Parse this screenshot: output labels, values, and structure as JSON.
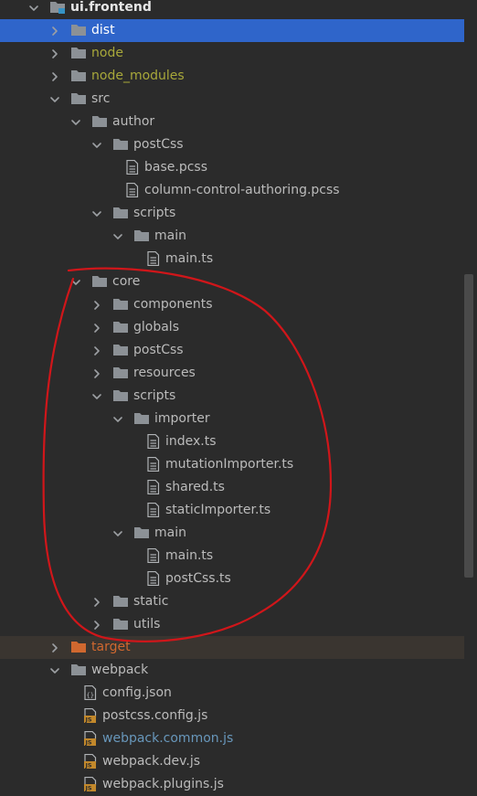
{
  "colors": {
    "default_text": "#bbbbbb",
    "ignored_text": "#a8a83a",
    "excluded_text": "#d0682f",
    "modified_text": "#6897bb",
    "selection": "#2f65ca",
    "folder_icon": "#8c9196",
    "annotation": "#d0161a"
  },
  "tree": [
    {
      "label": "ui.frontend",
      "depth": 1,
      "kind": "module-folder",
      "expanded": true,
      "bold": true
    },
    {
      "label": "dist",
      "depth": 2,
      "kind": "folder",
      "expanded": false,
      "selected": true
    },
    {
      "label": "node",
      "depth": 2,
      "kind": "folder",
      "expanded": false,
      "status": "ignored"
    },
    {
      "label": "node_modules",
      "depth": 2,
      "kind": "folder",
      "expanded": false,
      "status": "ignored"
    },
    {
      "label": "src",
      "depth": 2,
      "kind": "folder",
      "expanded": true
    },
    {
      "label": "author",
      "depth": 3,
      "kind": "folder",
      "expanded": true
    },
    {
      "label": "postCss",
      "depth": 4,
      "kind": "folder",
      "expanded": true
    },
    {
      "label": "base.pcss",
      "depth": 5,
      "kind": "file"
    },
    {
      "label": "column-control-authoring.pcss",
      "depth": 5,
      "kind": "file"
    },
    {
      "label": "scripts",
      "depth": 4,
      "kind": "folder",
      "expanded": true
    },
    {
      "label": "main",
      "depth": 5,
      "kind": "folder",
      "expanded": true
    },
    {
      "label": "main.ts",
      "depth": 6,
      "kind": "file"
    },
    {
      "label": "core",
      "depth": 3,
      "kind": "folder",
      "expanded": true
    },
    {
      "label": "components",
      "depth": 4,
      "kind": "folder",
      "expanded": false
    },
    {
      "label": "globals",
      "depth": 4,
      "kind": "folder",
      "expanded": false
    },
    {
      "label": "postCss",
      "depth": 4,
      "kind": "folder",
      "expanded": false
    },
    {
      "label": "resources",
      "depth": 4,
      "kind": "folder",
      "expanded": false
    },
    {
      "label": "scripts",
      "depth": 4,
      "kind": "folder",
      "expanded": true
    },
    {
      "label": "importer",
      "depth": 5,
      "kind": "folder",
      "expanded": true
    },
    {
      "label": "index.ts",
      "depth": 6,
      "kind": "file"
    },
    {
      "label": "mutationImporter.ts",
      "depth": 6,
      "kind": "file"
    },
    {
      "label": "shared.ts",
      "depth": 6,
      "kind": "file"
    },
    {
      "label": "staticImporter.ts",
      "depth": 6,
      "kind": "file"
    },
    {
      "label": "main",
      "depth": 5,
      "kind": "folder",
      "expanded": true
    },
    {
      "label": "main.ts",
      "depth": 6,
      "kind": "file"
    },
    {
      "label": "postCss.ts",
      "depth": 6,
      "kind": "file"
    },
    {
      "label": "static",
      "depth": 4,
      "kind": "folder",
      "expanded": false
    },
    {
      "label": "utils",
      "depth": 4,
      "kind": "folder",
      "expanded": false
    },
    {
      "label": "target",
      "depth": 2,
      "kind": "excluded-folder",
      "expanded": false,
      "status": "excluded"
    },
    {
      "label": "webpack",
      "depth": 2,
      "kind": "folder",
      "expanded": true
    },
    {
      "label": "config.json",
      "depth": 3,
      "kind": "json-file"
    },
    {
      "label": "postcss.config.js",
      "depth": 3,
      "kind": "js-file"
    },
    {
      "label": "webpack.common.js",
      "depth": 3,
      "kind": "js-file",
      "status": "modified"
    },
    {
      "label": "webpack.dev.js",
      "depth": 3,
      "kind": "js-file"
    },
    {
      "label": "webpack.plugins.js",
      "depth": 3,
      "kind": "js-file"
    }
  ],
  "icons": {
    "chevron_expanded": "chevron-down-icon",
    "chevron_collapsed": "chevron-right-icon",
    "folder": "folder-icon",
    "module_folder": "module-folder-icon",
    "excluded_folder": "excluded-folder-icon",
    "file": "text-file-icon",
    "json_file": "json-file-icon",
    "js_file": "js-file-icon"
  },
  "js_badge": "JS",
  "json_badge": "{}"
}
